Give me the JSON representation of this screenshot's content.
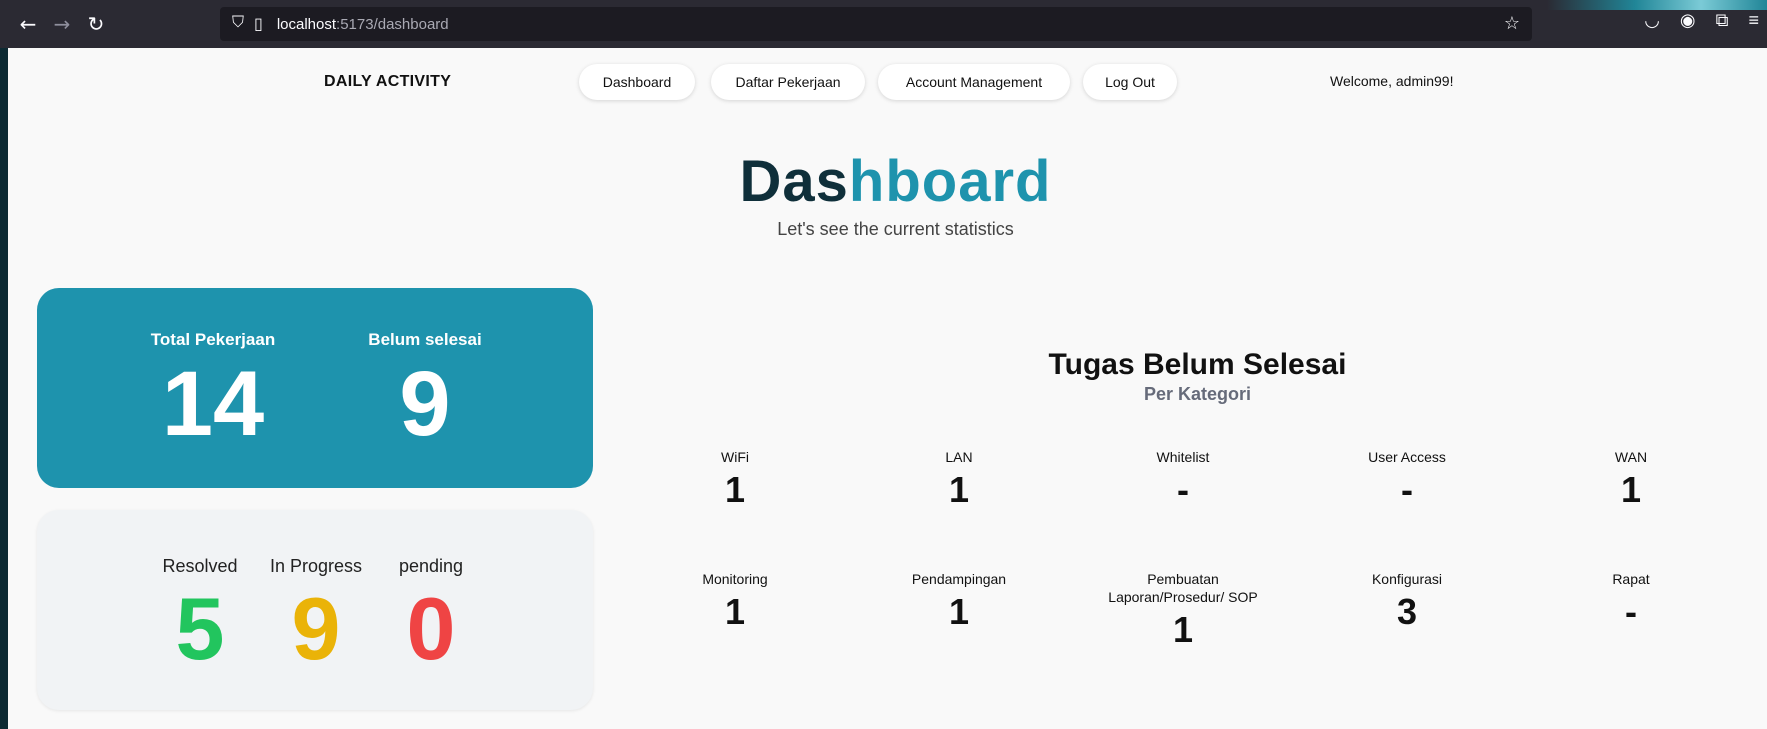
{
  "browser": {
    "url_host": "localhost",
    "url_path": ":5173/dashboard",
    "icons": [
      "back-icon",
      "forward-icon",
      "reload-icon",
      "shield-icon",
      "page-icon",
      "star-icon",
      "pocket-icon",
      "account-icon",
      "extensions-icon",
      "menu-icon"
    ]
  },
  "nav": {
    "brand": "DAILY ACTIVITY",
    "items": [
      "Dashboard",
      "Daftar Pekerjaan",
      "Account Management",
      "Log Out"
    ],
    "welcome": "Welcome, admin99!"
  },
  "header": {
    "title_dark": "Das",
    "title_accent": "hboard",
    "subtitle": "Let's see the current statistics"
  },
  "summary": {
    "total_label": "Total Pekerjaan",
    "total_value": "14",
    "unfinished_label": "Belum selesai",
    "unfinished_value": "9"
  },
  "status": {
    "resolved_label": "Resolved",
    "resolved_value": "5",
    "inprogress_label": "In Progress",
    "inprogress_value": "9",
    "pending_label": "pending",
    "pending_value": "0"
  },
  "categories": {
    "title": "Tugas Belum Selesai",
    "subtitle": "Per Kategori",
    "items": [
      {
        "label": "WiFi",
        "value": "1"
      },
      {
        "label": "LAN",
        "value": "1"
      },
      {
        "label": "Whitelist",
        "value": "-"
      },
      {
        "label": "User Access",
        "value": "-"
      },
      {
        "label": "WAN",
        "value": "1"
      },
      {
        "label": "Monitoring",
        "value": "1"
      },
      {
        "label": "Pendampingan",
        "value": "1"
      },
      {
        "label": "Pembuatan Laporan/Prosedur/ SOP",
        "value": "1"
      },
      {
        "label": "Konfigurasi",
        "value": "3"
      },
      {
        "label": "Rapat",
        "value": "-"
      }
    ]
  },
  "colors": {
    "primary": "#1e93ad",
    "title_dark": "#0f2f3a",
    "resolved": "#22c55e",
    "inprogress": "#eab308",
    "pending": "#ef4444"
  }
}
